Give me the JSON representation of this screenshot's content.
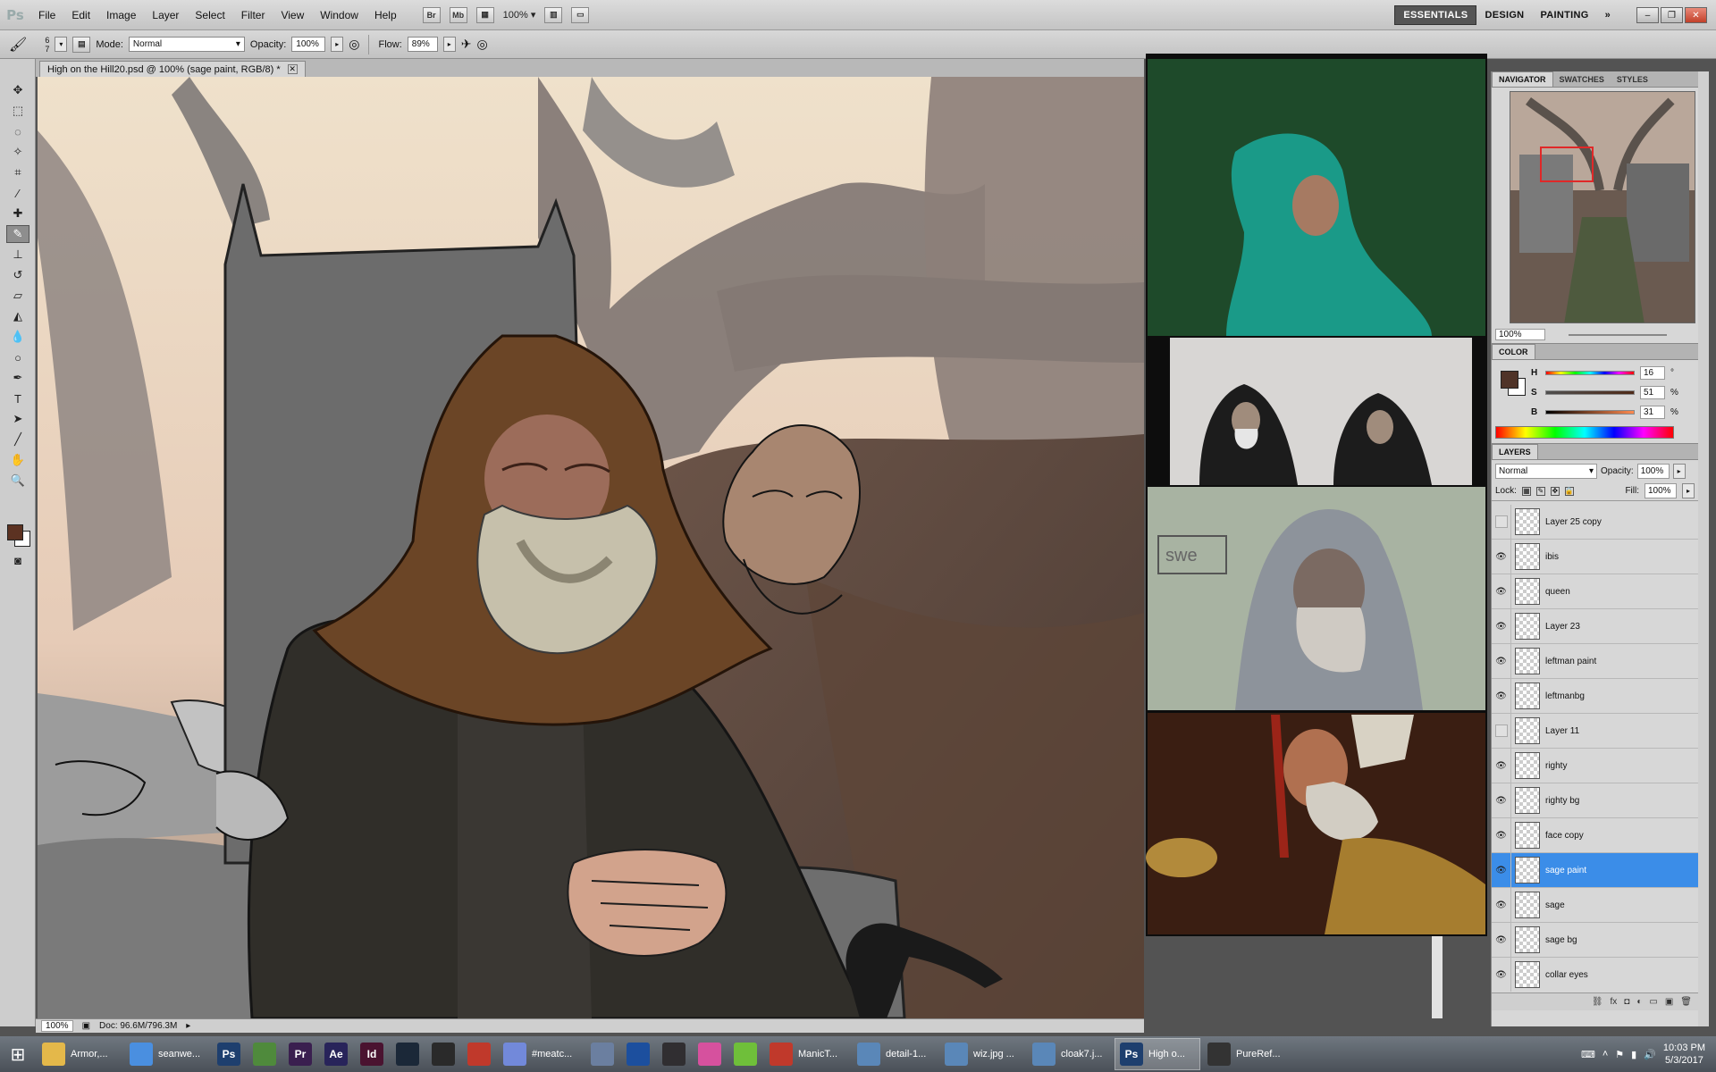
{
  "app": {
    "logo": "Ps",
    "menus": [
      "File",
      "Edit",
      "Image",
      "Layer",
      "Select",
      "Filter",
      "View",
      "Window",
      "Help"
    ],
    "bridge": "Br",
    "minibridge": "Mb",
    "zoom_menu": "100%",
    "workspaces": [
      "ESSENTIALS",
      "DESIGN",
      "PAINTING"
    ],
    "more_workspaces": "»"
  },
  "options": {
    "brush_size_top": "6",
    "brush_size_bottom": "7",
    "mode_label": "Mode:",
    "mode_value": "Normal",
    "opacity_label": "Opacity:",
    "opacity_value": "100%",
    "flow_label": "Flow:",
    "flow_value": "89%"
  },
  "document": {
    "tab_title": "High on the Hill20.psd @ 100% (sage paint, RGB/8) *",
    "zoom": "100%",
    "doc_size": "Doc: 96.6M/796.3M"
  },
  "reference": {
    "overlay_text": "swe"
  },
  "navigator": {
    "tabs": [
      "NAVIGATOR",
      "SWATCHES",
      "STYLES"
    ],
    "zoom": "100%"
  },
  "color": {
    "title": "COLOR",
    "h_label": "H",
    "h_value": "16",
    "h_unit": "°",
    "s_label": "S",
    "s_value": "51",
    "s_unit": "%",
    "b_label": "B",
    "b_value": "31",
    "b_unit": "%",
    "fg_color": "#4f3328"
  },
  "layers": {
    "title": "LAYERS",
    "blend_mode": "Normal",
    "opacity_label": "Opacity:",
    "opacity_value": "100%",
    "lock_label": "Lock:",
    "fill_label": "Fill:",
    "fill_value": "100%",
    "items": [
      {
        "name": "Layer 25 copy",
        "visible": false
      },
      {
        "name": "ibis",
        "visible": true
      },
      {
        "name": "queen",
        "visible": true
      },
      {
        "name": "Layer 23",
        "visible": true
      },
      {
        "name": "leftman paint",
        "visible": true
      },
      {
        "name": "leftmanbg",
        "visible": true
      },
      {
        "name": "Layer 11",
        "visible": false
      },
      {
        "name": "righty",
        "visible": true
      },
      {
        "name": "righty bg",
        "visible": true
      },
      {
        "name": "face copy",
        "visible": true
      },
      {
        "name": "sage paint",
        "visible": true,
        "selected": true
      },
      {
        "name": "sage",
        "visible": true
      },
      {
        "name": "sage bg",
        "visible": true
      },
      {
        "name": "collar eyes",
        "visible": true
      }
    ]
  },
  "taskbar": {
    "items": [
      {
        "label": "Armor,...",
        "icon": "folder-icon",
        "color": "#e4b84a"
      },
      {
        "label": "seanwe...",
        "icon": "chrome-icon",
        "color": "#4a8fe0"
      },
      {
        "label": "",
        "icon": "photoshop-icon",
        "color": "#1e3f6e",
        "text": "Ps"
      },
      {
        "label": "",
        "icon": "maps-icon",
        "color": "#4f8a3c"
      },
      {
        "label": "",
        "icon": "premiere-icon",
        "color": "#3a1f4f",
        "text": "Pr"
      },
      {
        "label": "",
        "icon": "aftereffects-icon",
        "color": "#28245a",
        "text": "Ae"
      },
      {
        "label": "",
        "icon": "indesign-icon",
        "color": "#4a1330",
        "text": "Id"
      },
      {
        "label": "",
        "icon": "steam-icon",
        "color": "#1b2838"
      },
      {
        "label": "",
        "icon": "figure-icon",
        "color": "#2a2a2a"
      },
      {
        "label": "",
        "icon": "timer-icon",
        "color": "#c0392b"
      },
      {
        "label": "#meatc...",
        "icon": "discord-icon",
        "color": "#7289da"
      },
      {
        "label": "",
        "icon": "feather-icon",
        "color": "#6b7fa0"
      },
      {
        "label": "",
        "icon": "cinema4d-icon",
        "color": "#1c4f9e"
      },
      {
        "label": "",
        "icon": "obs-icon",
        "color": "#302e31"
      },
      {
        "label": "",
        "icon": "itunes-icon",
        "color": "#d6519e"
      },
      {
        "label": "",
        "icon": "android-icon",
        "color": "#6fbf3a"
      },
      {
        "label": "ManicT...",
        "icon": "manictime-icon",
        "color": "#c0392b"
      },
      {
        "label": "detail-1...",
        "icon": "image-icon",
        "color": "#5a87b8"
      },
      {
        "label": "wiz.jpg ...",
        "icon": "image-icon",
        "color": "#5a87b8"
      },
      {
        "label": "cloak7.j...",
        "icon": "image-icon",
        "color": "#5a87b8"
      },
      {
        "label": "High o...",
        "icon": "photoshop-icon",
        "color": "#1e3f6e",
        "text": "Ps",
        "active": true
      },
      {
        "label": "PureRef...",
        "icon": "pureref-icon",
        "color": "#333333"
      }
    ],
    "time": "10:03 PM",
    "date": "5/3/2017"
  }
}
